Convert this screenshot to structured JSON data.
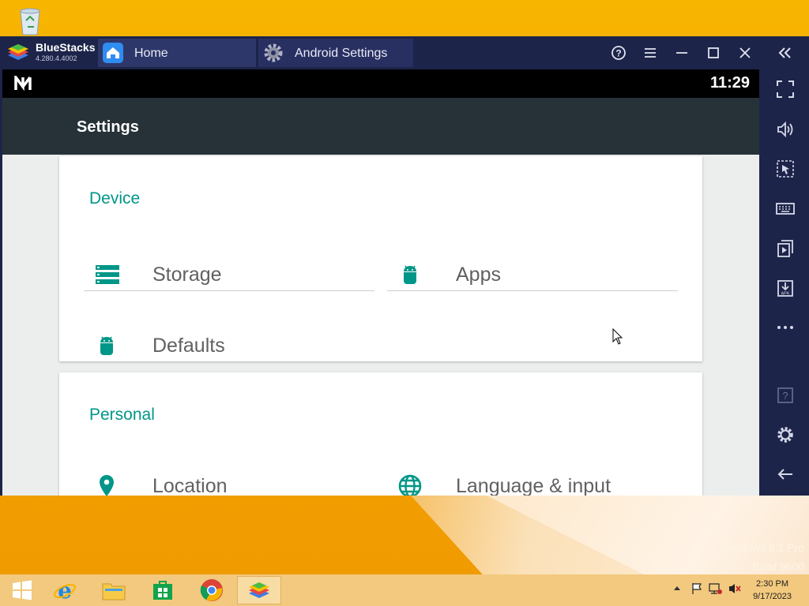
{
  "desktop": {
    "watermark_line1": "Windows 8.1 Pro",
    "watermark_line2": "Build 9600"
  },
  "bluestacks": {
    "app_name": "BlueStacks",
    "version": "4.280.4.4002",
    "tabs": [
      {
        "label": "Home",
        "icon": "home-icon"
      },
      {
        "label": "Android Settings",
        "icon": "gear-icon"
      }
    ],
    "toolbar_icons": [
      "help-icon",
      "menu-icon",
      "minimize-icon",
      "maximize-icon",
      "close-icon",
      "collapse-sidebar-icon"
    ]
  },
  "android": {
    "status": {
      "time": "11:29"
    },
    "appbar_title": "Settings",
    "sections": [
      {
        "title": "Device",
        "items": [
          {
            "label": "Storage",
            "icon": "storage-icon"
          },
          {
            "label": "Apps",
            "icon": "android-icon"
          },
          {
            "label": "Defaults",
            "icon": "android-icon"
          }
        ]
      },
      {
        "title": "Personal",
        "items": [
          {
            "label": "Location",
            "icon": "location-pin-icon"
          },
          {
            "label": "Language & input",
            "icon": "globe-icon"
          }
        ]
      }
    ],
    "accent": "#009688"
  },
  "sidebar_icons": [
    "fullscreen-icon",
    "volume-icon",
    "pointer-select-icon",
    "keyboard-icon",
    "multi-instance-icon",
    "install-apk-icon",
    "more-icon",
    "help-icon",
    "settings-icon",
    "back-icon"
  ],
  "taskbar": {
    "apps": [
      "start-icon",
      "internet-explorer-icon",
      "file-explorer-icon",
      "store-icon",
      "chrome-icon",
      "bluestacks-icon"
    ],
    "time": "2:30 PM",
    "date": "9/17/2023"
  }
}
